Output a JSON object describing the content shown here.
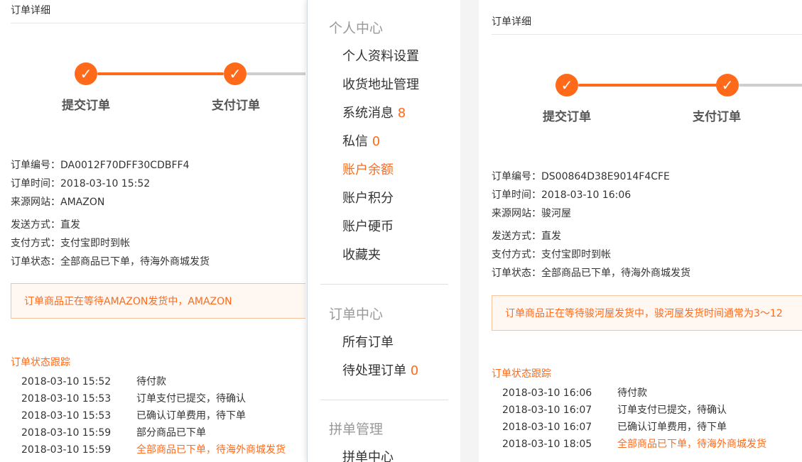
{
  "left": {
    "title": "订单详细",
    "steps": [
      "提交订单",
      "支付订单"
    ],
    "info": [
      {
        "label": "订单编号：",
        "value": "DA0012F70DFF30CDBFF4"
      },
      {
        "label": "订单时间：",
        "value": "2018-03-10 15:52"
      },
      {
        "label": "来源网站：",
        "value": "AMAZON"
      },
      {
        "label": "发送方式：",
        "value": "直发"
      },
      {
        "label": "支付方式：",
        "value": "支付宝即时到帐"
      },
      {
        "label": "订单状态：",
        "value": "全部商品已下单，待海外商城发货"
      }
    ],
    "notice": "订单商品正在等待AMAZON发货中，AMAZON",
    "tracking_title": "订单状态跟踪",
    "tracking": [
      {
        "time": "2018-03-10 15:52",
        "status": "待付款"
      },
      {
        "time": "2018-03-10 15:53",
        "status": "订单支付已提交，待确认"
      },
      {
        "time": "2018-03-10 15:53",
        "status": "已确认订单费用，待下单"
      },
      {
        "time": "2018-03-10 15:59",
        "status": "部分商品已下单"
      },
      {
        "time": "2018-03-10 15:59",
        "status": "全部商品已下单，待海外商城发货"
      }
    ]
  },
  "menu": {
    "sections": [
      {
        "title": "个人中心",
        "items": [
          {
            "label": "个人资料设置",
            "count": ""
          },
          {
            "label": "收货地址管理",
            "count": ""
          },
          {
            "label": "系统消息",
            "count": "8"
          },
          {
            "label": "私信",
            "count": "0"
          },
          {
            "label": "账户余额",
            "count": ""
          },
          {
            "label": "账户积分",
            "count": ""
          },
          {
            "label": "账户硬币",
            "count": ""
          },
          {
            "label": "收藏夹",
            "count": ""
          }
        ]
      },
      {
        "title": "订单中心",
        "items": [
          {
            "label": "所有订单",
            "count": ""
          },
          {
            "label": "待处理订单",
            "count": "0"
          }
        ]
      },
      {
        "title": "拼单管理",
        "items": [
          {
            "label": "拼单中心",
            "count": ""
          }
        ]
      }
    ]
  },
  "right": {
    "title": "订单详细",
    "steps": [
      "提交订单",
      "支付订单"
    ],
    "info": [
      {
        "label": "订单编号：",
        "value": "DS00864D38E9014F4CFE"
      },
      {
        "label": "订单时间：",
        "value": "2018-03-10 16:06"
      },
      {
        "label": "来源网站：",
        "value": "骏河屋"
      },
      {
        "label": "发送方式：",
        "value": "直发"
      },
      {
        "label": "支付方式：",
        "value": "支付宝即时到帐"
      },
      {
        "label": "订单状态：",
        "value": "全部商品已下单，待海外商城发货"
      }
    ],
    "notice": "订单商品正在等待骏河屋发货中，骏河屋发货时间通常为3～12",
    "tracking_title": "订单状态跟踪",
    "tracking": [
      {
        "time": "2018-03-10 16:06",
        "status": "待付款"
      },
      {
        "time": "2018-03-10 16:07",
        "status": "订单支付已提交，待确认"
      },
      {
        "time": "2018-03-10 16:07",
        "status": "已确认订单费用，待下单"
      },
      {
        "time": "2018-03-10 18:05",
        "status": "全部商品已下单，待海外商城发货"
      }
    ]
  },
  "icons": {
    "step_done": "check-icon"
  },
  "colors": {
    "accent": "#ff6a1a",
    "muted": "#999999"
  }
}
